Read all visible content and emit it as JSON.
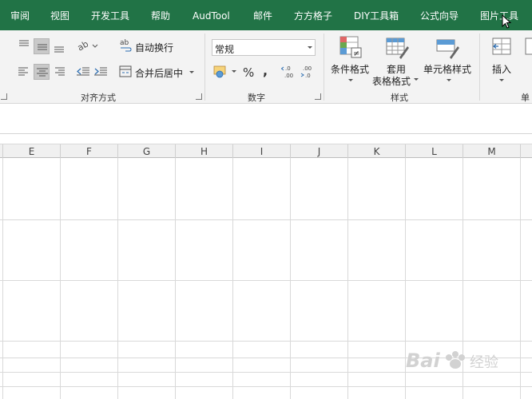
{
  "tabs": [
    "审阅",
    "视图",
    "开发工具",
    "帮助",
    "AudTool",
    "邮件",
    "方方格子",
    "DIY工具箱",
    "公式向导",
    "图片工具"
  ],
  "alignment": {
    "wrap_text": "自动换行",
    "merge_center": "合并后居中",
    "group_label": "对齐方式"
  },
  "number": {
    "format_value": "常规",
    "percent": "%",
    "comma": ",",
    "group_label": "数字"
  },
  "styles": {
    "conditional_format": "条件格式",
    "format_as_table_1": "套用",
    "format_as_table_2": "表格格式",
    "cell_styles": "单元格样式",
    "group_label": "样式"
  },
  "cells": {
    "insert": "插入",
    "group_label_partial": "单"
  },
  "columns": [
    "E",
    "F",
    "G",
    "H",
    "I",
    "J",
    "K",
    "L",
    "M"
  ],
  "colors": {
    "tab_bar": "#217346",
    "ribbon_bg": "#f3f3f3",
    "grid_line": "#d9d9d9"
  }
}
